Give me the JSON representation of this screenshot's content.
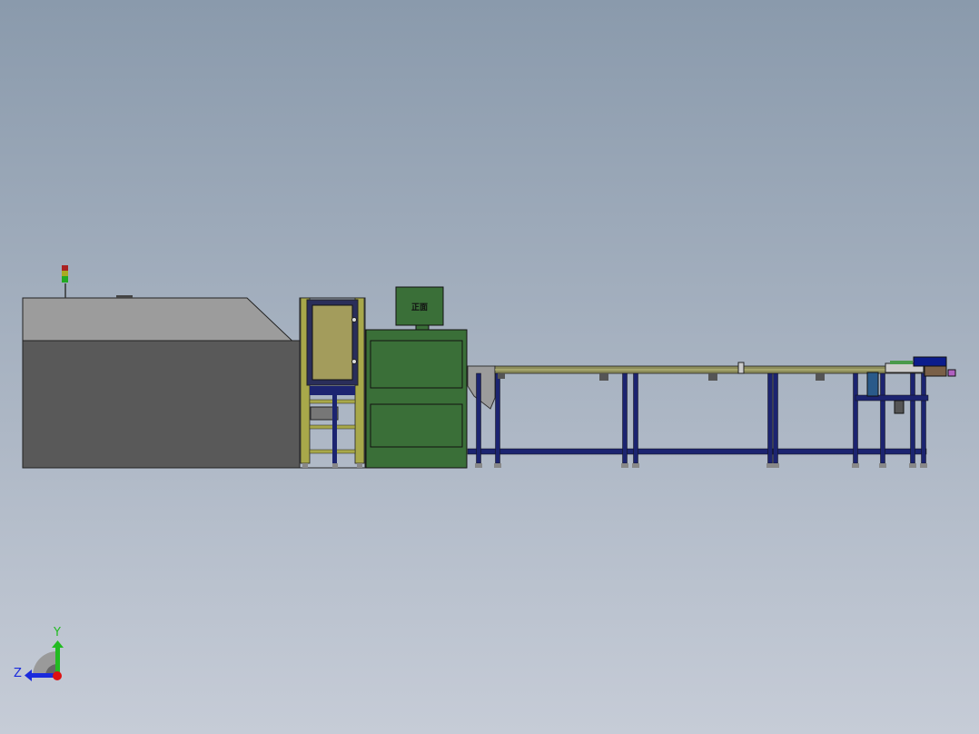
{
  "viewport": {
    "background_top": "#8a9aac",
    "background_bottom": "#c6ccd7"
  },
  "model": {
    "monitor_label": "正面",
    "colors": {
      "enclosure_top": "#9c9c9c",
      "enclosure_body": "#595959",
      "frame_yellow": "#a8a84a",
      "door_panel": "#a39c5c",
      "machine_green": "#3a6f38",
      "conveyor_rail": "#8c8c5a",
      "leg_navy": "#1c2470",
      "end_unit_blue": "#0c1c8c",
      "end_unit_brown": "#7a6048",
      "end_unit_purple": "#b060c0"
    }
  },
  "triad": {
    "y_label": "Y",
    "z_label": "Z",
    "y_color": "#22bb22",
    "z_color": "#1a2adc",
    "x_color": "#dd1111"
  }
}
